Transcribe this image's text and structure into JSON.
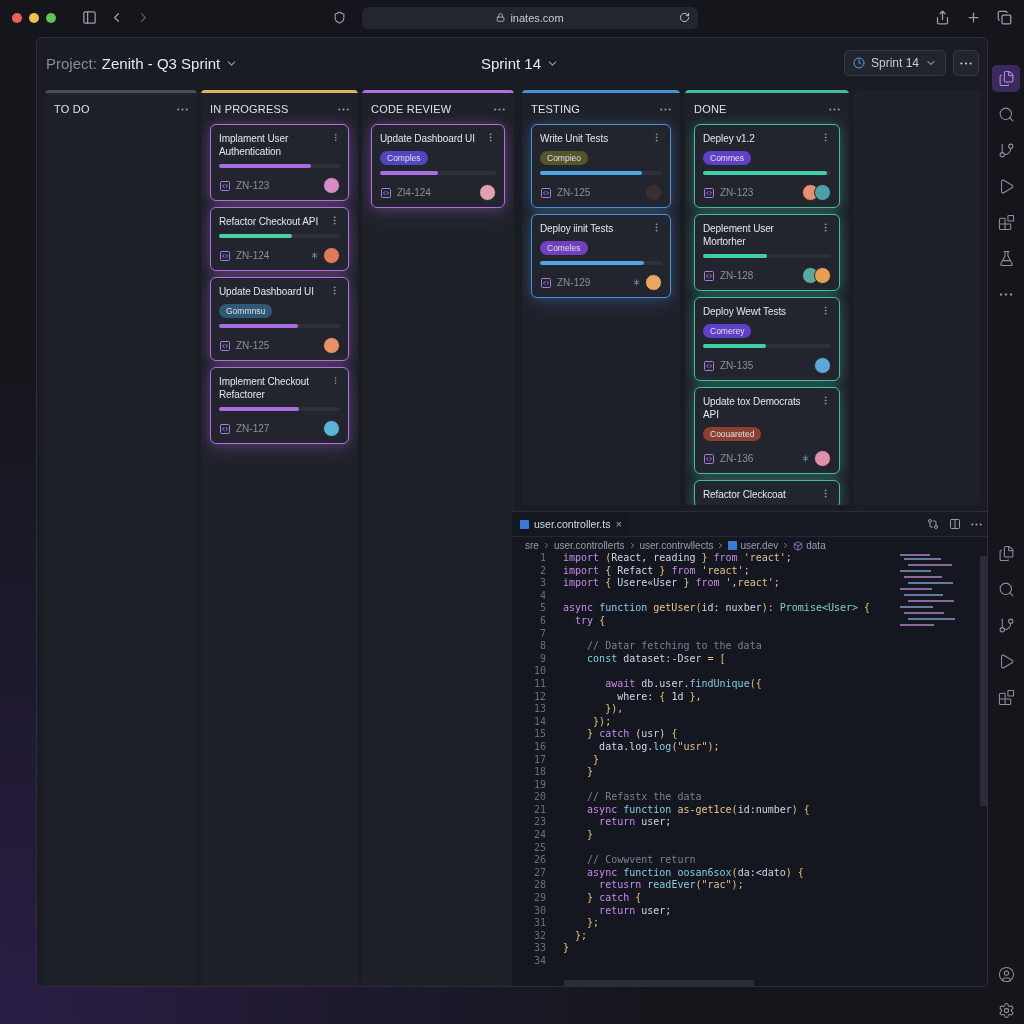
{
  "browser": {
    "url": "inates.com"
  },
  "header": {
    "project_label": "Project:",
    "project_name": "Zenith - Q3 Sprint",
    "sprint_title": "Sprint 14",
    "sprint_button": "Sprint 14"
  },
  "columns": [
    {
      "name": "TO DO",
      "color": "#4a4d58"
    },
    {
      "name": "IN PROGRESS",
      "color": "#e0b45a",
      "cards": [
        {
          "title": "Implament User Authentication",
          "color": "#b36ee0",
          "progress": {
            "level": 0.76,
            "color": "#a86ee0"
          },
          "id": "ZN-123",
          "avatars": [
            {
              "color": "#d98bc4"
            }
          ],
          "linked": false
        },
        {
          "title": "Refactor Checkout API",
          "color": "#b36ee0",
          "progress": {
            "level": 0.6,
            "color": "#4cd0a0"
          },
          "id": "ZN-124",
          "avatars": [
            {
              "color": "#e07a5a"
            }
          ],
          "linked": true
        },
        {
          "title": "Update Dashboard UI",
          "color": "#b36ee0",
          "tag": {
            "label": "Gommnsu",
            "color": "#2e5873"
          },
          "progress": {
            "level": 0.65,
            "color": "#a86ee0"
          },
          "id": "ZN-125",
          "avatars": [
            {
              "color": "#e8906a"
            }
          ],
          "linked": false
        },
        {
          "title": "Implement Checkout Refactorer",
          "color": "#b36ee0",
          "progress": {
            "level": 0.66,
            "color": "#a86ee0"
          },
          "id": "ZN-127",
          "avatars": [
            {
              "color": "#5ab4d8"
            }
          ],
          "linked": false
        }
      ]
    },
    {
      "name": "CODE REVIEW",
      "color": "#b36ee0",
      "cards": [
        {
          "title": "Update Dashboard UI",
          "color": "#b36ee0",
          "tag": {
            "label": "Comples",
            "color": "#5146c0"
          },
          "progress": {
            "level": 0.5,
            "color": "#a86ee0"
          },
          "id": "Zl4-124",
          "avatars": [
            {
              "color": "#e0a0b0"
            }
          ],
          "linked": false
        }
      ]
    },
    {
      "name": "TESTING",
      "color": "#4a90d9",
      "cards": [
        {
          "title": "Write Unit Tests",
          "color": "#4a90d9",
          "tag": {
            "label": "Compieo",
            "color": "#55552a"
          },
          "progress": {
            "level": 0.84,
            "color": "#4aa8e8"
          },
          "id": "ZN-125",
          "avatars": [
            {
              "color": "#3a3030"
            }
          ],
          "linked": false
        },
        {
          "title": "Deploy iinit Tests",
          "color": "#4a90d9",
          "tag": {
            "label": "Comeles",
            "color": "#7040c0"
          },
          "progress": {
            "level": 0.85,
            "color": "#4aa8e8"
          },
          "id": "ZN-129",
          "avatars": [
            {
              "color": "#e8a860"
            }
          ],
          "linked": true
        }
      ]
    },
    {
      "name": "DONE",
      "color": "#3fbfa0",
      "cards": [
        {
          "title": "Depley v1.2",
          "color": "#3fbfa0",
          "tag": {
            "label": "Commes",
            "color": "#6040c8"
          },
          "progress": {
            "level": 0.97,
            "color": "#3fd0a8"
          },
          "id": "ZN-123",
          "avatars": [
            {
              "color": "#e89070"
            },
            {
              "color": "#4aa0a8"
            }
          ],
          "linked": false
        },
        {
          "title": "Deplement User Mortorher",
          "color": "#3fbfa0",
          "progress": {
            "level": 0.5,
            "color": "#3fd0a8"
          },
          "id": "ZN-128",
          "avatars": [
            {
              "color": "#5aa8a0"
            },
            {
              "color": "#e8a050"
            }
          ],
          "linked": false
        },
        {
          "title": "Deploy Wewt Tests",
          "color": "#3fbfa0",
          "tag": {
            "label": "Comerey",
            "color": "#6040c8"
          },
          "progress": {
            "level": 0.49,
            "color": "#3fd0a8"
          },
          "id": "ZN-135",
          "avatars": [
            {
              "color": "#5aa8d8"
            }
          ],
          "linked": false
        },
        {
          "title": "Update tox Democrats API",
          "color": "#3fbfa0",
          "tag": {
            "label": "Coouareted",
            "color": "#8c4030"
          },
          "id": "ZN-136",
          "avatars": [
            {
              "color": "#e090a8"
            }
          ],
          "linked": true
        },
        {
          "title": "Refactor Cleckcoat",
          "color": "#3fbfa0"
        }
      ]
    }
  ],
  "editor": {
    "tab": "user.controller.ts",
    "tab_close": "×",
    "breadcrumbs": [
      {
        "label": "sre"
      },
      {
        "label": "user.controllerts"
      },
      {
        "label": "user.contrwllects"
      },
      {
        "label": "user.dev",
        "kind": "file"
      },
      {
        "label": "data",
        "kind": "symbol"
      }
    ],
    "lines": [
      {
        "n": "1",
        "t": [
          {
            "kind": "kw",
            "text": "import"
          },
          {
            "kind": "p",
            "text": " ("
          },
          {
            "kind": "id",
            "text": "React, reading "
          },
          {
            "kind": "p",
            "text": "} "
          },
          {
            "kind": "kw",
            "text": "from "
          },
          {
            "kind": "str",
            "text": "'react'"
          },
          {
            "kind": "p",
            "text": ";"
          }
        ]
      },
      {
        "n": "2",
        "t": [
          {
            "kind": "kw",
            "text": "import"
          },
          {
            "kind": "p",
            "text": " { "
          },
          {
            "kind": "id",
            "text": "Refact "
          },
          {
            "kind": "p",
            "text": "} "
          },
          {
            "kind": "kw",
            "text": "from "
          },
          {
            "kind": "str",
            "text": "'react'"
          },
          {
            "kind": "p",
            "text": ";"
          }
        ]
      },
      {
        "n": "3",
        "t": [
          {
            "kind": "kw",
            "text": "import"
          },
          {
            "kind": "p",
            "text": " { "
          },
          {
            "kind": "id",
            "text": "Usere«User "
          },
          {
            "kind": "p",
            "text": "} "
          },
          {
            "kind": "kw",
            "text": "from "
          },
          {
            "kind": "str",
            "text": "',react'"
          },
          {
            "kind": "p",
            "text": ";"
          }
        ]
      },
      {
        "n": "4"
      },
      {
        "n": "5",
        "t": [
          {
            "kind": "kw",
            "text": "async "
          },
          {
            "kind": "fn2",
            "text": "function "
          },
          {
            "kind": "fn",
            "text": "getUser"
          },
          {
            "kind": "p",
            "text": "("
          },
          {
            "kind": "id",
            "text": "id: nuxber"
          },
          {
            "kind": "p",
            "text": "): "
          },
          {
            "kind": "ty",
            "text": "Promise<User> "
          },
          {
            "kind": "p",
            "text": "{"
          }
        ]
      },
      {
        "n": "6",
        "t": [
          {
            "kind": "kw",
            "text": "  try "
          },
          {
            "kind": "p",
            "text": "{"
          }
        ]
      },
      {
        "n": "7"
      },
      {
        "n": "8",
        "t": [
          {
            "kind": "cm",
            "text": "    // Datar fetching to the data"
          }
        ]
      },
      {
        "n": "9",
        "t": [
          {
            "kind": "fn2",
            "text": "    const "
          },
          {
            "kind": "id",
            "text": "dataset:-Dser "
          },
          {
            "kind": "p",
            "text": "= ["
          }
        ]
      },
      {
        "n": "10"
      },
      {
        "n": "11",
        "t": [
          {
            "kind": "kw",
            "text": "       await "
          },
          {
            "kind": "id",
            "text": "db.user."
          },
          {
            "kind": "fn2",
            "text": "findUnique"
          },
          {
            "kind": "p",
            "text": "({"
          }
        ]
      },
      {
        "n": "12",
        "t": [
          {
            "kind": "id",
            "text": "         where: "
          },
          {
            "kind": "p",
            "text": "{ "
          },
          {
            "kind": "id",
            "text": "1d "
          },
          {
            "kind": "p",
            "text": "},"
          }
        ]
      },
      {
        "n": "13",
        "t": [
          {
            "kind": "p",
            "text": "       }),"
          }
        ]
      },
      {
        "n": "14",
        "t": [
          {
            "kind": "p",
            "text": "     });"
          }
        ]
      },
      {
        "n": "15",
        "t": [
          {
            "kind": "p",
            "text": "    } "
          },
          {
            "kind": "kw",
            "text": "catch "
          },
          {
            "kind": "id",
            "text": "(usr) "
          },
          {
            "kind": "p",
            "text": "{"
          }
        ]
      },
      {
        "n": "16",
        "t": [
          {
            "kind": "id",
            "text": "      data.log."
          },
          {
            "kind": "fn2",
            "text": "log"
          },
          {
            "kind": "p",
            "text": "("
          },
          {
            "kind": "str",
            "text": "\"usr\""
          },
          {
            "kind": "p",
            "text": ");"
          }
        ]
      },
      {
        "n": "17",
        "t": [
          {
            "kind": "p",
            "text": "     }"
          }
        ]
      },
      {
        "n": "18",
        "t": [
          {
            "kind": "p",
            "text": "    }"
          }
        ]
      },
      {
        "n": "19"
      },
      {
        "n": "20",
        "t": [
          {
            "kind": "cm",
            "text": "    // Refastx the data"
          }
        ]
      },
      {
        "n": "21",
        "t": [
          {
            "kind": "kw",
            "text": "    async "
          },
          {
            "kind": "fn2",
            "text": "function "
          },
          {
            "kind": "fn",
            "text": "as-get1ce"
          },
          {
            "kind": "p",
            "text": "("
          },
          {
            "kind": "id",
            "text": "id:number"
          },
          {
            "kind": "p",
            "text": ") {"
          }
        ]
      },
      {
        "n": "23",
        "t": [
          {
            "kind": "kw",
            "text": "      return "
          },
          {
            "kind": "id",
            "text": "user;"
          }
        ]
      },
      {
        "n": "24",
        "t": [
          {
            "kind": "p",
            "text": "    }"
          }
        ]
      },
      {
        "n": "25"
      },
      {
        "n": "26",
        "t": [
          {
            "kind": "cm",
            "text": "    // Cowwvent return"
          }
        ]
      },
      {
        "n": "27",
        "t": [
          {
            "kind": "kw",
            "text": "    async "
          },
          {
            "kind": "fn2",
            "text": "function "
          },
          {
            "kind": "fn2",
            "text": "oosan6sox"
          },
          {
            "kind": "p",
            "text": "("
          },
          {
            "kind": "id",
            "text": "da:<dato"
          },
          {
            "kind": "p",
            "text": ") {"
          }
        ]
      },
      {
        "n": "28",
        "t": [
          {
            "kind": "kw",
            "text": "      retusrn "
          },
          {
            "kind": "fn2",
            "text": "readEver"
          },
          {
            "kind": "p",
            "text": "("
          },
          {
            "kind": "str",
            "text": "\"rac\""
          },
          {
            "kind": "p",
            "text": ");"
          }
        ]
      },
      {
        "n": "29",
        "t": [
          {
            "kind": "p",
            "text": "    } "
          },
          {
            "kind": "kw",
            "text": "catch "
          },
          {
            "kind": "p",
            "text": "{"
          }
        ]
      },
      {
        "n": "30",
        "t": [
          {
            "kind": "kw",
            "text": "      return "
          },
          {
            "kind": "id",
            "text": "user;"
          }
        ]
      },
      {
        "n": "31",
        "t": [
          {
            "kind": "p",
            "text": "    };"
          }
        ]
      },
      {
        "n": "32",
        "t": [
          {
            "kind": "p",
            "text": "  };"
          }
        ]
      },
      {
        "n": "33",
        "t": [
          {
            "kind": "p",
            "text": "}"
          }
        ]
      },
      {
        "n": "34"
      }
    ]
  },
  "activity_top": [
    {
      "kind": "files",
      "selected": true
    },
    {
      "kind": "search",
      "selected": false
    },
    {
      "kind": "branch",
      "selected": false
    },
    {
      "kind": "run",
      "selected": false
    },
    {
      "kind": "extensions",
      "selected": false
    },
    {
      "kind": "flask",
      "selected": false
    },
    {
      "kind": "more",
      "selected": false
    }
  ],
  "activity_mid": [
    {
      "kind": "files",
      "selected": false
    },
    {
      "kind": "search",
      "selected": false
    },
    {
      "kind": "branch",
      "selected": false
    },
    {
      "kind": "run",
      "selected": false
    },
    {
      "kind": "extensions",
      "selected": false
    }
  ],
  "activity_bottom": [
    {
      "kind": "account",
      "selected": false
    },
    {
      "kind": "settings",
      "selected": false
    }
  ]
}
